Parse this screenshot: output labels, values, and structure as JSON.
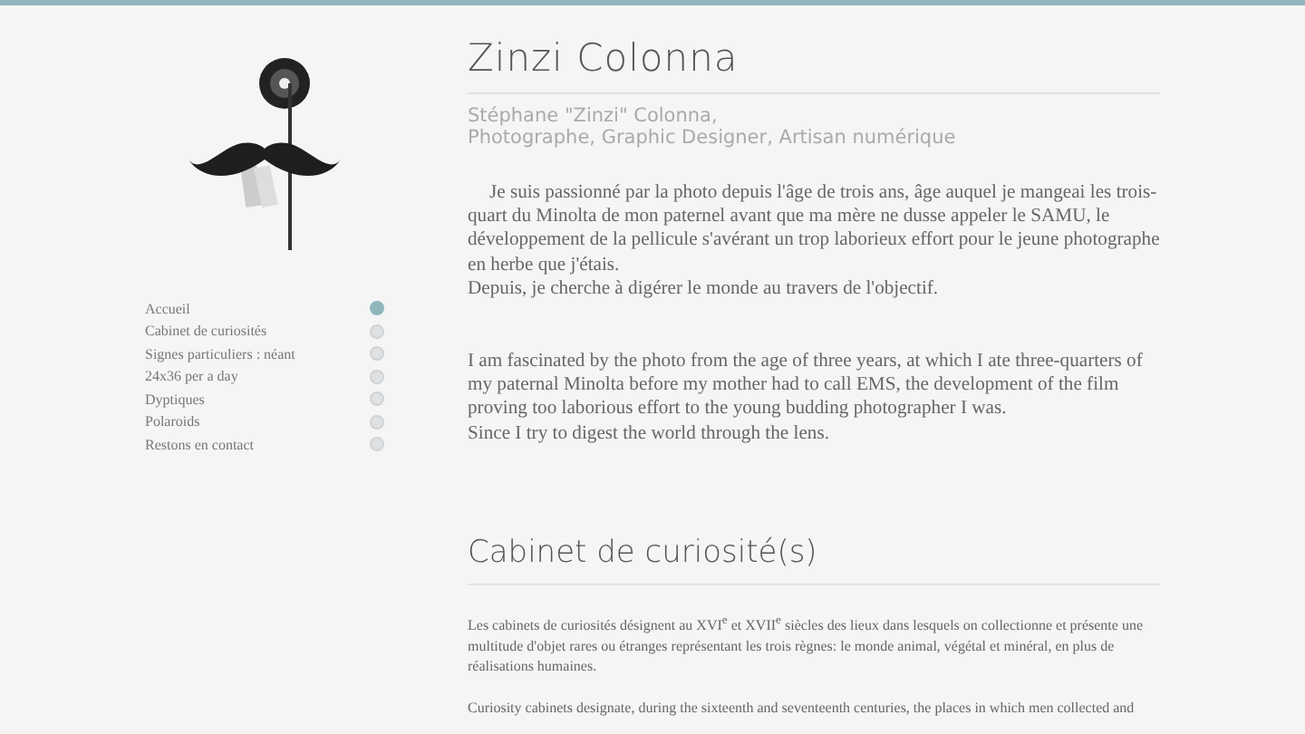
{
  "nav": [
    {
      "label": "Accueil",
      "selected": true
    },
    {
      "label": "Cabinet de curiosités",
      "selected": false
    },
    {
      "label": "Signes particuliers : néant",
      "selected": false
    },
    {
      "label": "24x36 per a day",
      "selected": false
    },
    {
      "label": "Dyptiques",
      "selected": false
    },
    {
      "label": "Polaroids",
      "selected": false
    },
    {
      "label": "Restons en contact",
      "selected": false
    }
  ],
  "intro": {
    "title": "Zinzi Colonna",
    "subtitle": [
      "Stéphane \"Zinzi\" Colonna,",
      "Photographe, Graphic Designer, Artisan numérique"
    ],
    "paragraphs": [
      [
        "Je suis passionné par la photo depuis l'âge de trois ans, âge auquel je mangeai les trois-quart du Minolta de mon paternel avant que ma mère ne dusse appeler le SAMU, le développement de la pellicule s'avérant un trop laborieux effort pour le jeune photographe en herbe que j'étais.",
        "Depuis, je cherche à digérer le monde au travers de l'objectif."
      ],
      [
        "I am fascinated by the photo from the age of three years, at which I ate three-quarters of my paternal Minolta before my mother had to call EMS, the development of the film proving too laborious effort to the young budding photographer I was.",
        "Since I try to digest the world through the lens."
      ]
    ]
  },
  "cabinet": {
    "title": "Cabinet de curiosité(s)",
    "paragraphs": [
      "Les cabinets de curiosités désignent au XVI$^{e}$ et XVII$^{e}$ siècles des lieux dans lesquels on collectionne et présente une multitude d'objet rares ou étranges représentant les trois règnes: le monde animal, végétal et minéral, en plus de réalisations humaines.",
      " Curiosity cabinets designate, during the sixteenth and seventeenth centuries, the places in which men collected and"
    ]
  }
}
